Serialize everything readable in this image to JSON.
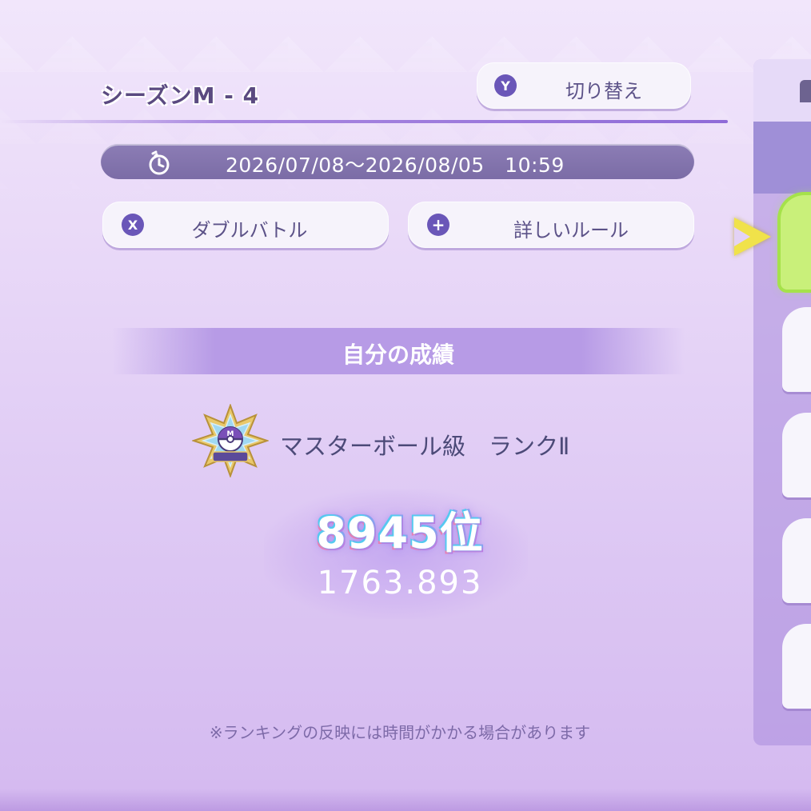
{
  "header": {
    "season_title": "シーズンM - 4",
    "switch_button": {
      "key": "Y",
      "label": "切り替え"
    }
  },
  "period": {
    "icon": "stopwatch-icon",
    "text": "2026/07/08〜2026/08/05　10:59"
  },
  "buttons": {
    "battle_format": {
      "key": "X",
      "label": "ダブルバトル"
    },
    "rules": {
      "key": "+",
      "label": "詳しいルール"
    }
  },
  "results": {
    "section_title": "自分の成績",
    "rank_emblem_icon": "master-ball-rank-emblem-icon",
    "rank_text": "マスターボール級　ランクⅡ",
    "placing": "8945位",
    "rating": "1763.893"
  },
  "footnote": "※ランキングの反映には時間がかかる場合があります",
  "colors": {
    "accent": "#6a56b8",
    "text_primary": "#4c4a78",
    "active_slot": "#c9f07a",
    "cursor": "#f0e24a"
  }
}
